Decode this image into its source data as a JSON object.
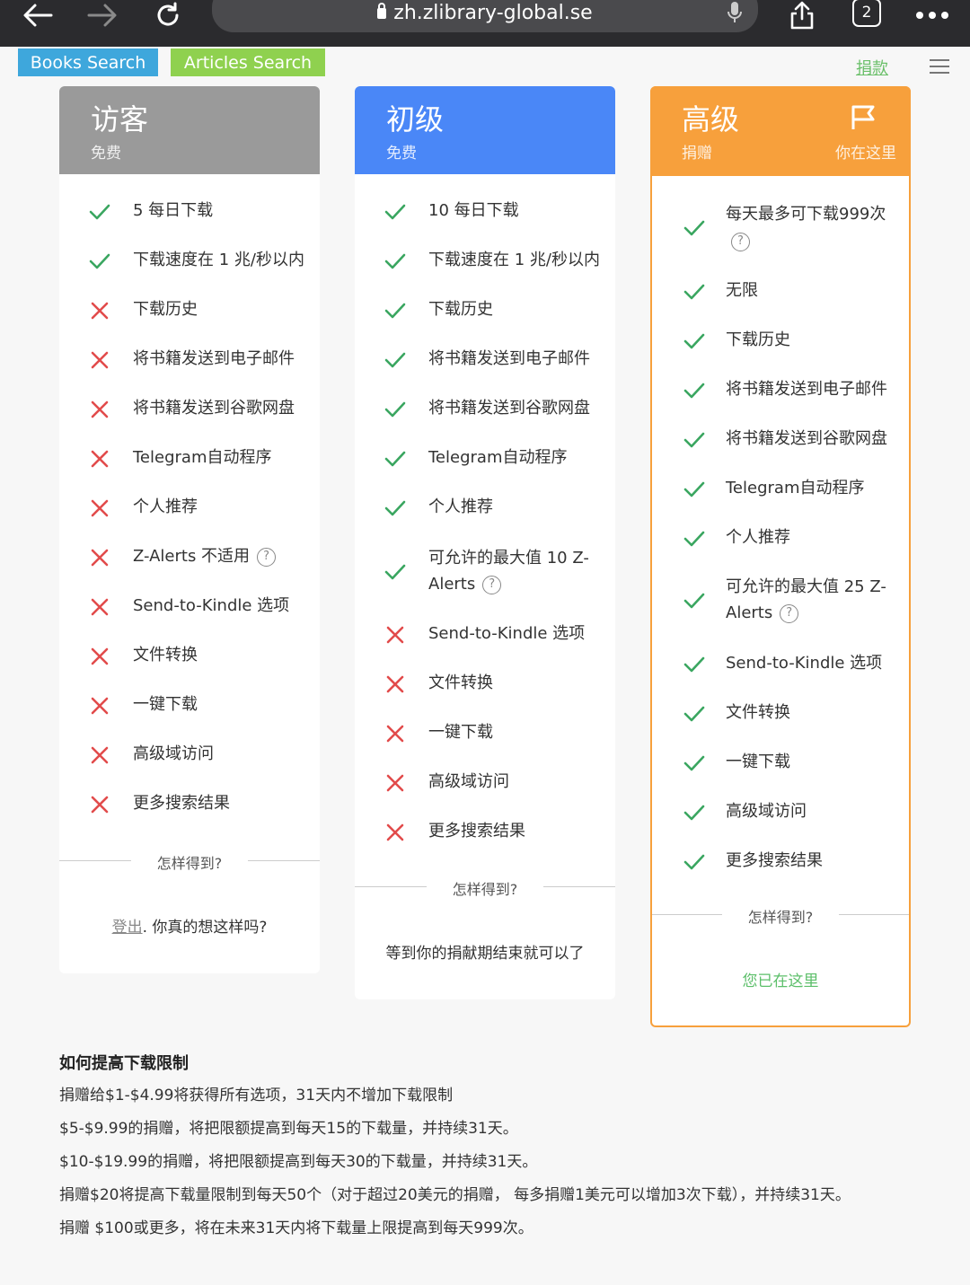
{
  "browser": {
    "url": "zh.zlibrary-global.se",
    "tab_count": "2"
  },
  "nav": {
    "books_search": "Books Search",
    "articles_search": "Articles Search",
    "donate": "捐款"
  },
  "colors": {
    "books_search": "#3ea7dc",
    "articles_search": "#8fd14f",
    "guest": "#9a9a9a",
    "basic": "#4a87f7",
    "premium": "#f7a03c",
    "check": "#3aa660",
    "cross": "#e24b4b"
  },
  "plans": {
    "guest": {
      "title": "访客",
      "subtitle": "免费",
      "features": [
        {
          "ok": true,
          "text": "5 每日下载"
        },
        {
          "ok": true,
          "text": "下载速度在 1 兆/秒以内"
        },
        {
          "ok": false,
          "text": "下载历史"
        },
        {
          "ok": false,
          "text": "将书籍发送到电子邮件"
        },
        {
          "ok": false,
          "text": "将书籍发送到谷歌网盘"
        },
        {
          "ok": false,
          "text": "Telegram自动程序"
        },
        {
          "ok": false,
          "text": "个人推荐"
        },
        {
          "ok": false,
          "text": "Z-Alerts 不适用"
        },
        {
          "ok": false,
          "text": "Send-to-Kindle 选项"
        },
        {
          "ok": false,
          "text": "文件转换"
        },
        {
          "ok": false,
          "text": "一键下载"
        },
        {
          "ok": false,
          "text": "高级域访问"
        },
        {
          "ok": false,
          "text": "更多搜索结果"
        }
      ],
      "how_to": "怎样得到?",
      "footer_link": "登出",
      "footer_text": ". 你真的想这样吗?"
    },
    "basic": {
      "title": "初级",
      "subtitle": "免费",
      "features": [
        {
          "ok": true,
          "text": "10 每日下载"
        },
        {
          "ok": true,
          "text": "下载速度在 1 兆/秒以内"
        },
        {
          "ok": true,
          "text": "下载历史"
        },
        {
          "ok": true,
          "text": "将书籍发送到电子邮件"
        },
        {
          "ok": true,
          "text": "将书籍发送到谷歌网盘"
        },
        {
          "ok": true,
          "text": "Telegram自动程序"
        },
        {
          "ok": true,
          "text": "个人推荐"
        },
        {
          "ok": true,
          "text": "可允许的最大值 10 Z-Alerts"
        },
        {
          "ok": false,
          "text": "Send-to-Kindle 选项"
        },
        {
          "ok": false,
          "text": "文件转换"
        },
        {
          "ok": false,
          "text": "一键下载"
        },
        {
          "ok": false,
          "text": "高级域访问"
        },
        {
          "ok": false,
          "text": "更多搜索结果"
        }
      ],
      "how_to": "怎样得到?",
      "footer_text": "等到你的捐献期结束就可以了"
    },
    "premium": {
      "title": "高级",
      "subtitle": "捐赠",
      "here_label": "你在这里",
      "features": [
        {
          "ok": true,
          "text": "每天最多可下载999次"
        },
        {
          "ok": true,
          "text": "无限"
        },
        {
          "ok": true,
          "text": "下载历史"
        },
        {
          "ok": true,
          "text": "将书籍发送到电子邮件"
        },
        {
          "ok": true,
          "text": "将书籍发送到谷歌网盘"
        },
        {
          "ok": true,
          "text": "Telegram自动程序"
        },
        {
          "ok": true,
          "text": "个人推荐"
        },
        {
          "ok": true,
          "text": "可允许的最大值 25 Z-Alerts"
        },
        {
          "ok": true,
          "text": "Send-to-Kindle 选项"
        },
        {
          "ok": true,
          "text": "文件转换"
        },
        {
          "ok": true,
          "text": "一键下载"
        },
        {
          "ok": true,
          "text": "高级域访问"
        },
        {
          "ok": true,
          "text": "更多搜索结果"
        }
      ],
      "how_to": "怎样得到?",
      "footer_text": "您已在这里"
    }
  },
  "info": {
    "heading": "如何提高下载限制",
    "lines": [
      "捐赠给$1-$4.99将获得所有选项，31天内不增加下载限制",
      "$5-$9.99的捐赠，将把限额提高到每天15的下载量，并持续31天。",
      "$10-$19.99的捐赠，将把限额提高到每天30的下载量，并持续31天。",
      "捐赠$20将提高下载量限制到每天50个（对于超过20美元的捐赠， 每多捐赠1美元可以增加3次下载），并持续31天。",
      "捐赠 $100或更多，将在未来31天内将下载量上限提高到每天999次。"
    ]
  }
}
